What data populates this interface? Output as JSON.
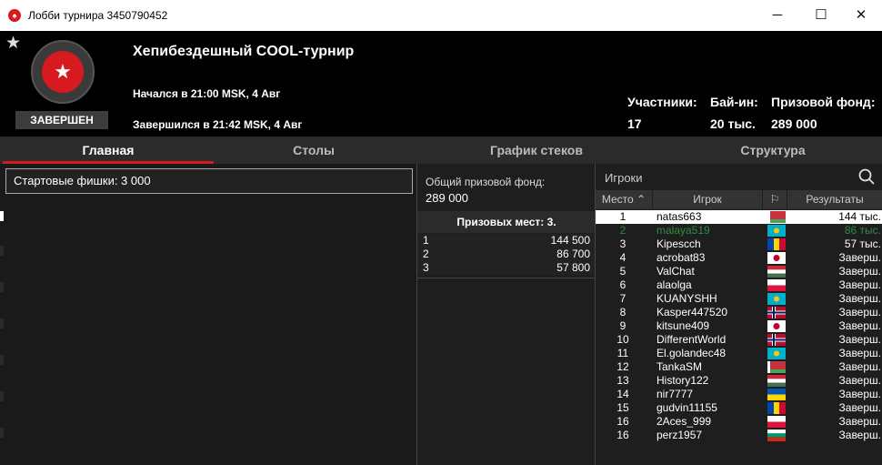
{
  "window": {
    "title": "Лобби турнира 3450790452",
    "minimize": "─",
    "maximize": "☐",
    "close": "✕"
  },
  "header": {
    "name": "Хепибездешный COOL-турнир",
    "started": "Начался в 21:00 MSK, 4 Авг",
    "finished": "Завершился в 21:42 MSK, 4 Авг",
    "status": "ЗАВЕРШЕН",
    "stats": [
      {
        "label": "Участники:",
        "value": "17"
      },
      {
        "label": "Бай-ин:",
        "value": "20 тыс."
      },
      {
        "label": "Призовой фонд:",
        "value": "289 000"
      }
    ]
  },
  "tabs": [
    "Главная",
    "Столы",
    "График стеков",
    "Структура"
  ],
  "main": {
    "starting_chips": "Стартовые фишки:  3 000"
  },
  "prizes": {
    "pool_label": "Общий призовой фонд:",
    "pool_value": "289 000",
    "places_label": "Призовых мест: 3.",
    "rows": [
      {
        "place": "1",
        "amount": "144 500"
      },
      {
        "place": "2",
        "amount": "86 700"
      },
      {
        "place": "3",
        "amount": "57 800"
      }
    ]
  },
  "players": {
    "search_label": "Игроки",
    "columns": {
      "place": "Место",
      "player": "Игрок",
      "result": "Результаты"
    },
    "rows": [
      {
        "place": "1",
        "name": "natas663",
        "flag": "belarus",
        "result": "144 тыс."
      },
      {
        "place": "2",
        "name": "malaya519",
        "flag": "kazakhstan",
        "result": "86 тыс."
      },
      {
        "place": "3",
        "name": "Kipescch",
        "flag": "moldova",
        "result": "57 тыс."
      },
      {
        "place": "4",
        "name": "acrobat83",
        "flag": "japan",
        "result": "Заверш."
      },
      {
        "place": "5",
        "name": "ValChat",
        "flag": "hungary",
        "result": "Заверш."
      },
      {
        "place": "6",
        "name": "alaolga",
        "flag": "white-red",
        "result": "Заверш."
      },
      {
        "place": "7",
        "name": "KUANYSHH",
        "flag": "kazakhstan",
        "result": "Заверш."
      },
      {
        "place": "8",
        "name": "Kasper447520",
        "flag": "norway",
        "result": "Заверш."
      },
      {
        "place": "9",
        "name": "kitsune409",
        "flag": "japan",
        "result": "Заверш."
      },
      {
        "place": "10",
        "name": "DifferentWorld",
        "flag": "norway",
        "result": "Заверш."
      },
      {
        "place": "11",
        "name": "El.golandec48",
        "flag": "kazakhstan",
        "result": "Заверш."
      },
      {
        "place": "12",
        "name": "TankaSM",
        "flag": "belarus",
        "result": "Заверш."
      },
      {
        "place": "13",
        "name": "History122",
        "flag": "hungary",
        "result": "Заверш."
      },
      {
        "place": "14",
        "name": "nir7777",
        "flag": "ukraine",
        "result": "Заверш."
      },
      {
        "place": "15",
        "name": "gudvin11155",
        "flag": "moldova",
        "result": "Заверш."
      },
      {
        "place": "16",
        "name": "2Aces_999",
        "flag": "white-red",
        "result": "Заверш."
      },
      {
        "place": "16",
        "name": "perz1957",
        "flag": "bulgaria",
        "result": "Заверш."
      }
    ]
  },
  "colors": {
    "accent": "#d71920",
    "background": "#000000",
    "panel": "#1e1e1e",
    "highlight_row": "#ffffff",
    "second_place": "#2e8b3e"
  }
}
